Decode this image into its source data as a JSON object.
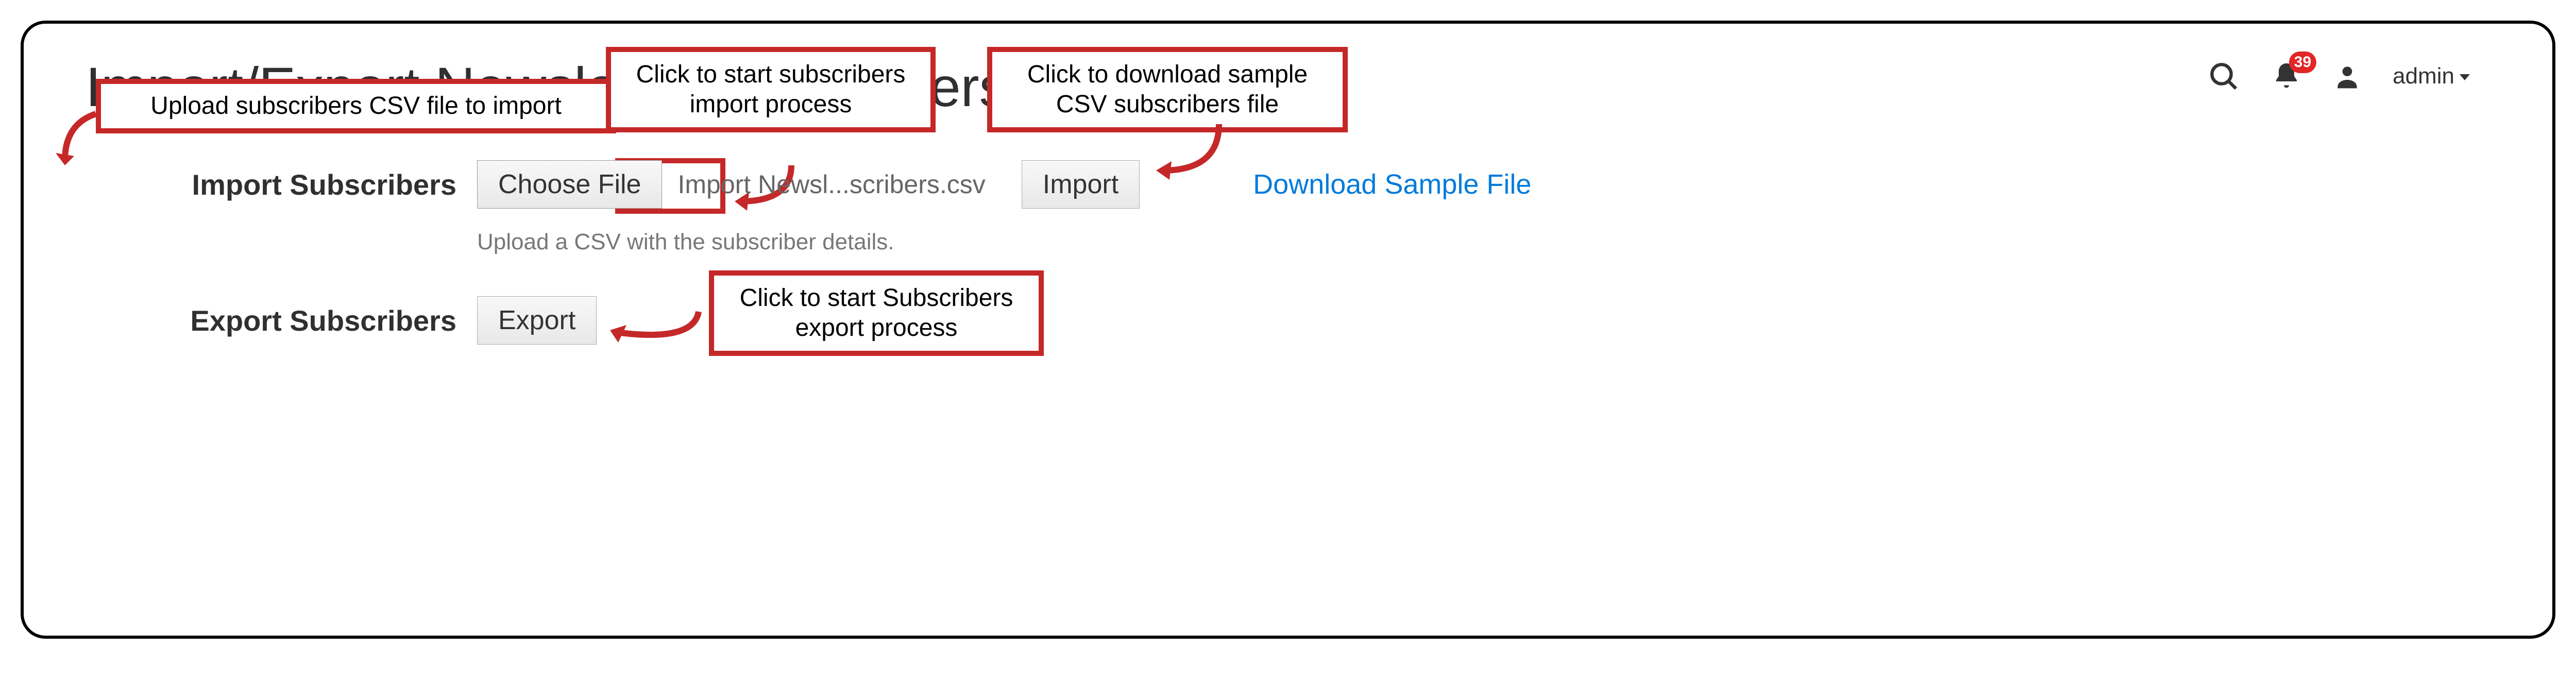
{
  "page": {
    "title": "Import/Export Newsletter Subscribers"
  },
  "header": {
    "notification_count": "39",
    "account_name": "admin"
  },
  "import_row": {
    "label": "Import Subscribers",
    "choose_button": "Choose File",
    "filename": "Import Newsl...scribers.csv",
    "import_button": "Import",
    "download_link": "Download Sample File",
    "hint": "Upload a CSV with the subscriber details."
  },
  "export_row": {
    "label": "Export Subscribers",
    "export_button": "Export"
  },
  "callouts": {
    "upload": "Upload subscribers CSV file to import",
    "import": "Click to start subscribers import process",
    "download": "Click to download sample CSV subscribers file",
    "export": "Click to start Subscribers export process"
  }
}
